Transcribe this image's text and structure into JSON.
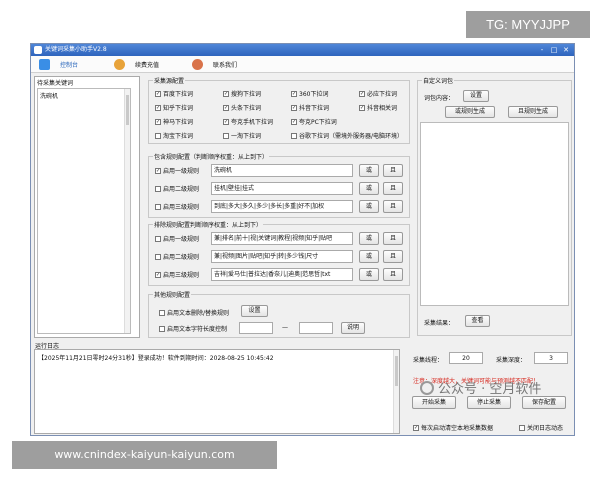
{
  "overlay": {
    "tg": "TG: MYYJJPP",
    "website": "www.cnindex-kaiyun-kaiyun.com",
    "watermark": "公众号 · 空月软件"
  },
  "window": {
    "title": "关键词采集小助手V2.8",
    "controls": [
      "-",
      "□",
      "✕"
    ]
  },
  "toolbar": {
    "tabs": [
      {
        "label": "控制台",
        "color": "#3a8ee6"
      },
      {
        "label": "续费充值",
        "color": "#e8a33a"
      },
      {
        "label": "联系我们",
        "color": "#d9734a"
      }
    ]
  },
  "left": {
    "header": "待采集关键词",
    "keyword": "洗碗机"
  },
  "sources": {
    "title": "采集源配置",
    "items": [
      {
        "label": "百度下拉词",
        "checked": true
      },
      {
        "label": "搜狗下拉词",
        "checked": true
      },
      {
        "label": "360下拉词",
        "checked": true
      },
      {
        "label": "必应下拉词",
        "checked": true
      },
      {
        "label": "知乎下拉词",
        "checked": true
      },
      {
        "label": "头条下拉词",
        "checked": true
      },
      {
        "label": "抖音下拉词",
        "checked": true
      },
      {
        "label": "抖音相关词",
        "checked": true
      },
      {
        "label": "神马下拉词",
        "checked": true
      },
      {
        "label": "夸克手机下拉词",
        "checked": true
      },
      {
        "label": "夸克PC下拉词",
        "checked": true
      },
      {
        "label": "淘宝下拉词",
        "checked": false
      },
      {
        "label": "一淘下拉词",
        "checked": false
      },
      {
        "label": "谷歌下拉词（需境外服务器/电脑环境）",
        "checked": false
      }
    ]
  },
  "include": {
    "title": "包含规则配置（判断顺序权重：从上到下）",
    "rows": [
      {
        "label": "启用一级规则",
        "checked": true,
        "value": "洗碗机",
        "or": "或",
        "and": "且"
      },
      {
        "label": "启用二级规则",
        "checked": false,
        "value": "挂机|壁挂|挂式",
        "or": "或",
        "and": "且"
      },
      {
        "label": "启用三级规则",
        "checked": false,
        "value": "到底|多大|多久|多少|多长|多重|好不|加权",
        "or": "或",
        "and": "且"
      }
    ]
  },
  "exclude": {
    "title": "排除规则配置判断顺序权重：从上到下）",
    "rows": [
      {
        "label": "启用一级规则",
        "checked": false,
        "value": "兼|排名|前十|视|关键词|教程|视频|知乎|贴吧",
        "or": "或",
        "and": "且"
      },
      {
        "label": "启用二级规则",
        "checked": false,
        "value": "兼|视频|图片|贴吧|知乎|转|多少钱|尺寸",
        "or": "或",
        "and": "且"
      },
      {
        "label": "启用三级规则",
        "checked": true,
        "value": "吉祥|爱马仕|普拉达|香奈儿|迪奥|范思哲|txt",
        "or": "或",
        "and": "且"
      }
    ]
  },
  "other": {
    "title": "其他规则配置",
    "replace_label": "启用文本删除/替换规则",
    "replace_btn": "设置",
    "length_label": "启用文本字符长度控制",
    "dash": "—",
    "explain_btn": "说明"
  },
  "custom": {
    "title": "自定义词包",
    "pack_label": "词包内容：",
    "pack_btn": "设置",
    "or_btn": "或规则生成",
    "and_btn": "且规则生成",
    "result_label": "采集结果：",
    "view_btn": "查看"
  },
  "log": {
    "title": "运行日志",
    "line": "【2025年11月21日零时24分31秒】登录成功！软件到期时间：2028-08-25 10:45:42"
  },
  "controls": {
    "thread_label": "采集线程：",
    "thread_value": "20",
    "depth_label": "采集深度：",
    "depth_value": "3",
    "warning": "注意：深度越大，关键词可能与预测越不匹配！",
    "start": "开始采集",
    "stop": "停止采集",
    "save": "保存配置",
    "auto_clear": "每次启动清空本地采集数据",
    "close_log": "关闭日志动态"
  }
}
